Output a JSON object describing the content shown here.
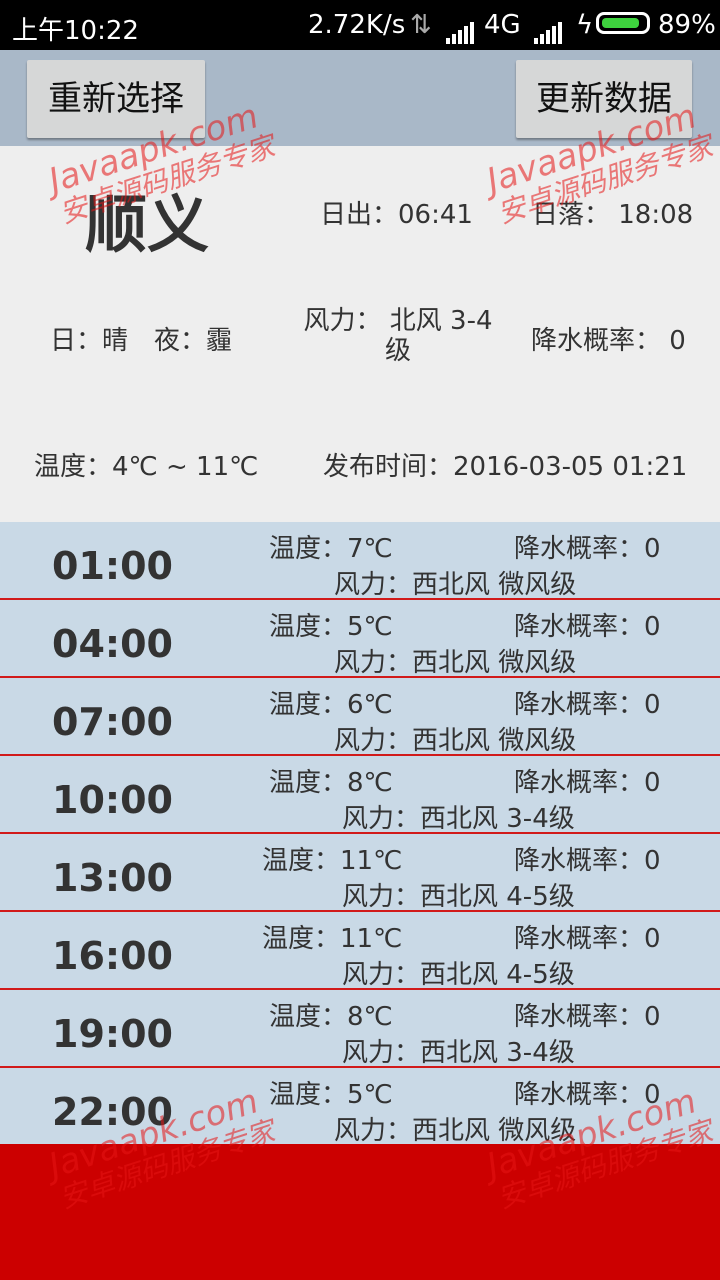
{
  "status_bar": {
    "time": "上午10:22",
    "speed": "2.72K/s",
    "network": "4G",
    "battery": "89%"
  },
  "toolbar": {
    "reselect_label": "重新选择",
    "refresh_label": "更新数据"
  },
  "summary": {
    "city": "顺义",
    "sunrise": "日出：06:41",
    "sunset": "日落： 18:08",
    "day_night": "日：晴　夜：霾",
    "wind": "风力： 北风 3-4级",
    "rain_probability": "降水概率： 0",
    "temperature": "温度：4℃ ~ 11℃",
    "publish_time": "发布时间：2016-03-05 01:21"
  },
  "hourly": [
    {
      "time": "01:00",
      "temp": "温度：7℃",
      "rain": "降水概率：0",
      "wind": "风力：西北风 微风级"
    },
    {
      "time": "04:00",
      "temp": "温度：5℃",
      "rain": "降水概率：0",
      "wind": "风力：西北风 微风级"
    },
    {
      "time": "07:00",
      "temp": "温度：6℃",
      "rain": "降水概率：0",
      "wind": "风力：西北风 微风级"
    },
    {
      "time": "10:00",
      "temp": "温度：8℃",
      "rain": "降水概率：0",
      "wind": "风力：西北风 3-4级"
    },
    {
      "time": "13:00",
      "temp": "温度：11℃",
      "rain": "降水概率：0",
      "wind": "风力：西北风 4-5级"
    },
    {
      "time": "16:00",
      "temp": "温度：11℃",
      "rain": "降水概率：0",
      "wind": "风力：西北风 4-5级"
    },
    {
      "time": "19:00",
      "temp": "温度：8℃",
      "rain": "降水概率：0",
      "wind": "风力：西北风 3-4级"
    },
    {
      "time": "22:00",
      "temp": "温度：5℃",
      "rain": "降水概率：0",
      "wind": "风力：西北风 微风级"
    }
  ],
  "watermark": {
    "line1": "Javaapk.com",
    "line2": "安卓源码服务专家"
  }
}
